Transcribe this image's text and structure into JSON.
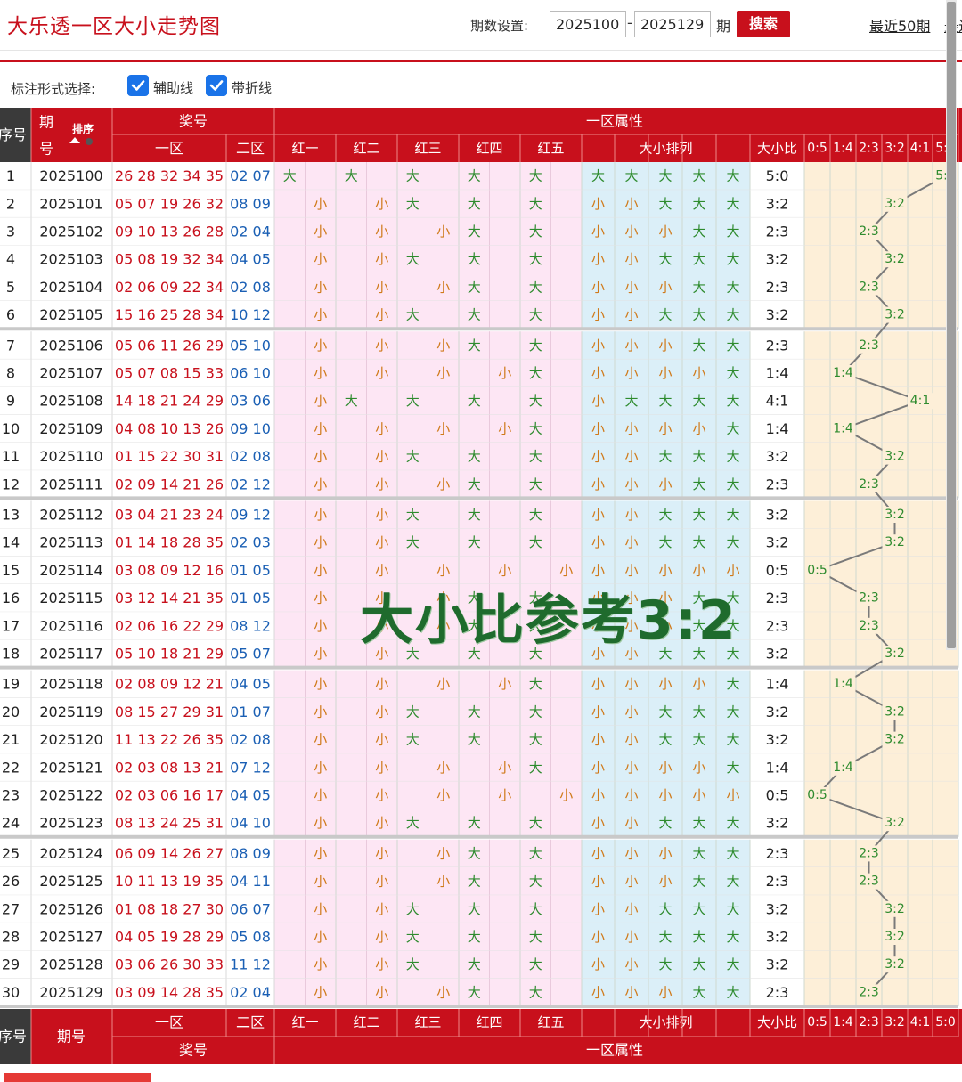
{
  "header": {
    "title": "大乐透一区大小走势图",
    "period_label": "期数设置:",
    "period_from": "2025100",
    "period_to": "2025129",
    "period_suffix": "期",
    "search_label": "搜索",
    "recent_label": "最近50期",
    "recent_label_2": "最近"
  },
  "options": {
    "label": "标注形式选择:",
    "checkbox_1": "辅助线",
    "checkbox_2": "带折线"
  },
  "columns": {
    "seq": "序号",
    "period": "期号",
    "period_top": "期",
    "period_bottom": "号",
    "sort": "排序",
    "prize": "奖号",
    "zone1": "一区",
    "zone2": "二区",
    "attr": "一区属性",
    "reds": [
      "红一",
      "红二",
      "红三",
      "红四",
      "红五"
    ],
    "size_order": "大小排列",
    "ratio": "大小比",
    "ratio_cols": [
      "0:5",
      "1:4",
      "2:3",
      "3:2",
      "4:1",
      "5:0"
    ],
    "big": "大",
    "small": "小"
  },
  "rows": [
    {
      "seq": "1",
      "period": "2025100",
      "front": "26 28 32 34 35",
      "back": "02 07",
      "size": "BBBBB",
      "ratio": "5:0"
    },
    {
      "seq": "2",
      "period": "2025101",
      "front": "05 07 19 26 32",
      "back": "08 09",
      "size": "SSBBB",
      "ratio": "3:2"
    },
    {
      "seq": "3",
      "period": "2025102",
      "front": "09 10 13 26 28",
      "back": "02 04",
      "size": "SSSBB",
      "ratio": "2:3"
    },
    {
      "seq": "4",
      "period": "2025103",
      "front": "05 08 19 32 34",
      "back": "04 05",
      "size": "SSBBB",
      "ratio": "3:2"
    },
    {
      "seq": "5",
      "period": "2025104",
      "front": "02 06 09 22 34",
      "back": "02 08",
      "size": "SSSBB",
      "ratio": "2:3"
    },
    {
      "seq": "6",
      "period": "2025105",
      "front": "15 16 25 28 34",
      "back": "10 12",
      "size": "SSBBB",
      "ratio": "3:2"
    },
    {
      "seq": "7",
      "period": "2025106",
      "front": "05 06 11 26 29",
      "back": "05 10",
      "size": "SSSBB",
      "ratio": "2:3"
    },
    {
      "seq": "8",
      "period": "2025107",
      "front": "05 07 08 15 33",
      "back": "06 10",
      "size": "SSSSB",
      "ratio": "1:4"
    },
    {
      "seq": "9",
      "period": "2025108",
      "front": "14 18 21 24 29",
      "back": "03 06",
      "size": "SBBBB",
      "ratio": "4:1"
    },
    {
      "seq": "10",
      "period": "2025109",
      "front": "04 08 10 13 26",
      "back": "09 10",
      "size": "SSSSB",
      "ratio": "1:4"
    },
    {
      "seq": "11",
      "period": "2025110",
      "front": "01 15 22 30 31",
      "back": "02 08",
      "size": "SSBBB",
      "ratio": "3:2"
    },
    {
      "seq": "12",
      "period": "2025111",
      "front": "02 09 14 21 26",
      "back": "02 12",
      "size": "SSSBB",
      "ratio": "2:3"
    },
    {
      "seq": "13",
      "period": "2025112",
      "front": "03 04 21 23 24",
      "back": "09 12",
      "size": "SSBBB",
      "ratio": "3:2"
    },
    {
      "seq": "14",
      "period": "2025113",
      "front": "01 14 18 28 35",
      "back": "02 03",
      "size": "SSBBB",
      "ratio": "3:2"
    },
    {
      "seq": "15",
      "period": "2025114",
      "front": "03 08 09 12 16",
      "back": "01 05",
      "size": "SSSSS",
      "ratio": "0:5"
    },
    {
      "seq": "16",
      "period": "2025115",
      "front": "03 12 14 21 35",
      "back": "01 05",
      "size": "SSSBB",
      "ratio": "2:3"
    },
    {
      "seq": "17",
      "period": "2025116",
      "front": "02 06 16 22 29",
      "back": "08 12",
      "size": "SSSBB",
      "ratio": "2:3"
    },
    {
      "seq": "18",
      "period": "2025117",
      "front": "05 10 18 21 29",
      "back": "05 07",
      "size": "SSBBB",
      "ratio": "3:2"
    },
    {
      "seq": "19",
      "period": "2025118",
      "front": "02 08 09 12 21",
      "back": "04 05",
      "size": "SSSSB",
      "ratio": "1:4"
    },
    {
      "seq": "20",
      "period": "2025119",
      "front": "08 15 27 29 31",
      "back": "01 07",
      "size": "SSBBB",
      "ratio": "3:2"
    },
    {
      "seq": "21",
      "period": "2025120",
      "front": "11 13 22 26 35",
      "back": "02 08",
      "size": "SSBBB",
      "ratio": "3:2"
    },
    {
      "seq": "22",
      "period": "2025121",
      "front": "02 03 08 13 21",
      "back": "07 12",
      "size": "SSSSB",
      "ratio": "1:4"
    },
    {
      "seq": "23",
      "period": "2025122",
      "front": "02 03 06 16 17",
      "back": "04 05",
      "size": "SSSSS",
      "ratio": "0:5"
    },
    {
      "seq": "24",
      "period": "2025123",
      "front": "08 13 24 25 31",
      "back": "04 10",
      "size": "SSBBB",
      "ratio": "3:2"
    },
    {
      "seq": "25",
      "period": "2025124",
      "front": "06 09 14 26 27",
      "back": "08 09",
      "size": "SSSBB",
      "ratio": "2:3"
    },
    {
      "seq": "26",
      "period": "2025125",
      "front": "10 11 13 19 35",
      "back": "04 11",
      "size": "SSSBB",
      "ratio": "2:3"
    },
    {
      "seq": "27",
      "period": "2025126",
      "front": "01 08 18 27 30",
      "back": "06 07",
      "size": "SSBBB",
      "ratio": "3:2"
    },
    {
      "seq": "28",
      "period": "2025127",
      "front": "04 05 19 28 29",
      "back": "05 08",
      "size": "SSBBB",
      "ratio": "3:2"
    },
    {
      "seq": "29",
      "period": "2025128",
      "front": "03 06 26 30 33",
      "back": "11 12",
      "size": "SSBBB",
      "ratio": "3:2"
    },
    {
      "seq": "30",
      "period": "2025129",
      "front": "03 09 14 28 35",
      "back": "02 04",
      "size": "SSSBB",
      "ratio": "2:3"
    }
  ],
  "watermark": "大小比参考3:2",
  "colors": {
    "brand_red": "#c8101c",
    "front_red": "#c8101c",
    "back_blue": "#1a5fb4",
    "big_green": "#2e8b2e",
    "small_orange": "#d07a1a",
    "pink_bg": "#fde6f4",
    "cyan_bg": "#dbeff8",
    "peach_bg": "#fdefd8"
  }
}
